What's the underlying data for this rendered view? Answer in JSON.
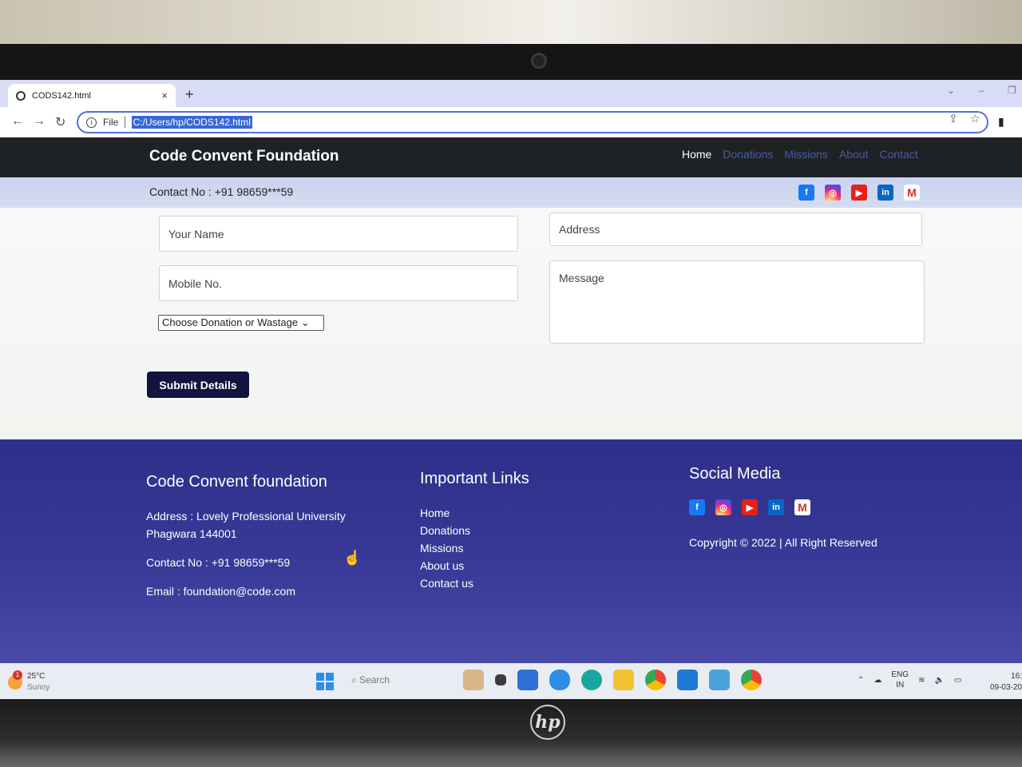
{
  "browser": {
    "tab_title": "CODS142.html",
    "tab_close": "×",
    "new_tab": "+",
    "scheme": "File",
    "url": "C:/Users/hp/CODS142.html"
  },
  "site": {
    "brand": "Code Convent Foundation",
    "nav": [
      "Home",
      "Donations",
      "Missions",
      "About",
      "Contact"
    ],
    "contact_strip": "Contact No : +91 98659***59"
  },
  "form": {
    "name_placeholder": "Your Name",
    "mobile_placeholder": "Mobile No.",
    "address_placeholder": "Address",
    "message_placeholder": "Message",
    "select_value": "Choose Donation or Wastage",
    "submit_label": "Submit Details"
  },
  "footer": {
    "about_title": "Code Convent foundation",
    "address": "Address : Lovely Professional University Phagwara 144001",
    "contact": "Contact No : +91 98659***59",
    "email": "Email : foundation@code.com",
    "links_title": "Important Links",
    "links": [
      "Home",
      "Donations",
      "Missions",
      "About us",
      "Contact us"
    ],
    "social_title": "Social Media",
    "copyright": "Copyright © 2022 | All Right Reserved"
  },
  "taskbar": {
    "temperature": "25°C",
    "weather": "Sunny",
    "badge": "1",
    "search": "Search",
    "lang": "ENG",
    "region": "IN",
    "time": "16:",
    "date": "09-03-20"
  },
  "social_icons": [
    "facebook-icon",
    "instagram-icon",
    "youtube-icon",
    "linkedin-icon",
    "gmail-icon"
  ],
  "colors": {
    "navbar": "#1f2224",
    "strip": "#c9d3ef",
    "submit": "#12133f",
    "footer": "#2d2f8a",
    "nav_link": "#4a5aa8"
  }
}
